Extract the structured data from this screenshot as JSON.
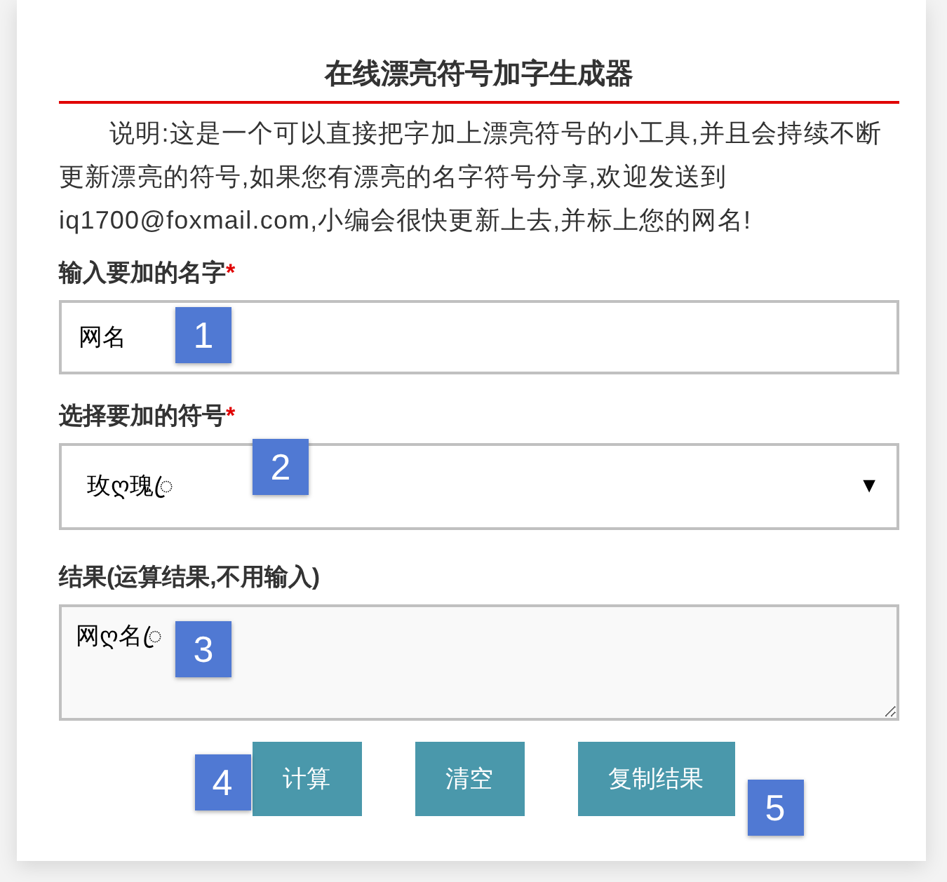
{
  "title": "在线漂亮符号加字生成器",
  "description": "说明:这是一个可以直接把字加上漂亮符号的小工具,并且会持续不断更新漂亮的符号,如果您有漂亮的名字符号分享,欢迎发送到iq1700@foxmail.com,小编会很快更新上去,并标上您的网名!",
  "fields": [
    {
      "kind": "input",
      "label": "输入要加的名字",
      "required_mark": "*",
      "value": "网名",
      "callout": "1"
    },
    {
      "kind": "select",
      "label": "选择要加的符号",
      "required_mark": "*",
      "value": "玫ღ瑰ꦿ",
      "caret": "▼",
      "callout": "2"
    },
    {
      "kind": "textarea",
      "label": "结果(运算结果,不用输入)",
      "value": "网ღ名ꦿ",
      "callout": "3"
    }
  ],
  "buttons": [
    {
      "label": "计算",
      "callout": "4"
    },
    {
      "label": "清空"
    },
    {
      "label": "复制结果",
      "callout": "5"
    }
  ]
}
